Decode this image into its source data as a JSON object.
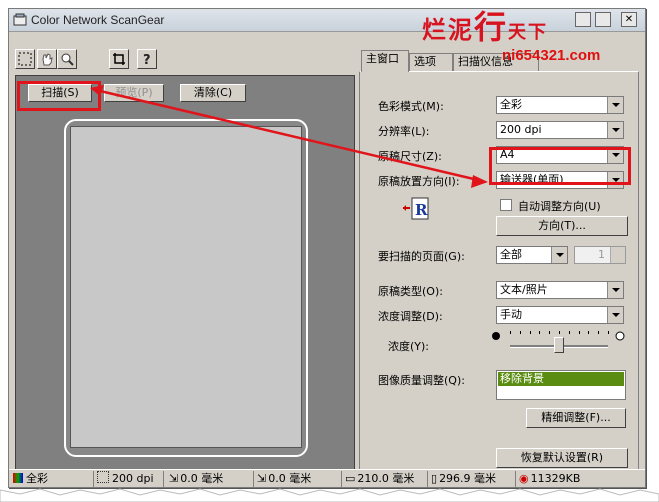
{
  "window": {
    "title": "Color Network ScanGear"
  },
  "watermark": {
    "chars": [
      "烂",
      "泥",
      "行",
      "天",
      "下"
    ],
    "url": "ni654321.com"
  },
  "preview_buttons": {
    "scan": "扫描(S)",
    "preview": "预览(P)",
    "clear": "清除(C)"
  },
  "tabs": [
    "主窗口",
    "选项",
    "扫描仪信息"
  ],
  "settings": {
    "color_mode": {
      "label": "色彩模式(M):",
      "value": "全彩"
    },
    "resolution": {
      "label": "分辨率(L):",
      "value": "200 dpi"
    },
    "original_size": {
      "label": "原稿尺寸(Z):",
      "value": "A4"
    },
    "orientation": {
      "label": "原稿放置方向(I):",
      "value": "输送器(单面)"
    },
    "auto_orientation": {
      "label": "自动调整方向(U)"
    },
    "direction_button": "方向(T)...",
    "pages": {
      "label": "要扫描的页面(G):",
      "value": "全部",
      "count": "1"
    },
    "original_type": {
      "label": "原稿类型(O):",
      "value": "文本/照片"
    },
    "density_adjust": {
      "label": "浓度调整(D):",
      "value": "手动"
    },
    "density": {
      "label": "浓度(Y):",
      "level": 0.5
    },
    "quality": {
      "label": "图像质量调整(Q):",
      "selected": "移除背景"
    },
    "fine_tune_button": "精细调整(F)...",
    "restore_button": "恢复默认设置(R)"
  },
  "status": {
    "color": "全彩",
    "dpi": "200 dpi",
    "x": "0.0 毫米",
    "y": "0.0 毫米",
    "w": "210.0 毫米",
    "h": "296.9 毫米",
    "size": "11329KB"
  },
  "colors": {
    "highlight": "#e0141a",
    "quality_selected": "#5a8c12"
  }
}
